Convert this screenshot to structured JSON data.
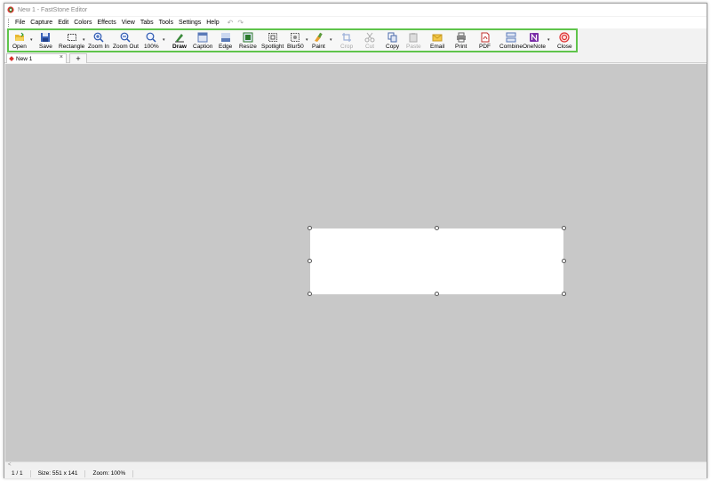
{
  "window": {
    "title": "New 1 - FastStone Editor"
  },
  "menubar": {
    "items": [
      "File",
      "Capture",
      "Edit",
      "Colors",
      "Effects",
      "View",
      "Tabs",
      "Tools",
      "Settings",
      "Help"
    ]
  },
  "toolbar": {
    "buttons": [
      {
        "label": "Open"
      },
      {
        "label": "Save"
      },
      {
        "label": "Rectangle"
      },
      {
        "label": "Zoom In"
      },
      {
        "label": "Zoom Out"
      },
      {
        "label": "100%"
      },
      {
        "label": "Draw"
      },
      {
        "label": "Caption"
      },
      {
        "label": "Edge"
      },
      {
        "label": "Resize"
      },
      {
        "label": "Spotlight"
      },
      {
        "label": "Blur50"
      },
      {
        "label": "Paint"
      },
      {
        "label": "Crop"
      },
      {
        "label": "Cut"
      },
      {
        "label": "Copy"
      },
      {
        "label": "Paste"
      },
      {
        "label": "Email"
      },
      {
        "label": "Print"
      },
      {
        "label": "PDF"
      },
      {
        "label": "Combine"
      },
      {
        "label": "OneNote"
      },
      {
        "label": "Close"
      }
    ],
    "highlight_color": "#5fc44b"
  },
  "tabs": {
    "active": "New 1",
    "close_glyph": "×",
    "add_glyph": "+"
  },
  "statusbar": {
    "page": "1 / 1",
    "size": "Size: 551 x 141",
    "zoom": "Zoom: 100%"
  }
}
